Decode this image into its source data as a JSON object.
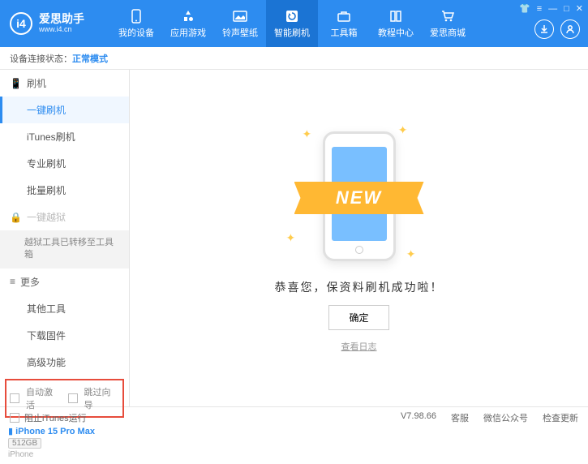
{
  "app": {
    "title": "爱思助手",
    "subtitle": "www.i4.cn"
  },
  "nav": {
    "items": [
      {
        "label": "我的设备"
      },
      {
        "label": "应用游戏"
      },
      {
        "label": "铃声壁纸"
      },
      {
        "label": "智能刷机"
      },
      {
        "label": "工具箱"
      },
      {
        "label": "教程中心"
      },
      {
        "label": "爱思商城"
      }
    ]
  },
  "status": {
    "label": "设备连接状态：",
    "mode": "正常模式"
  },
  "sidebar": {
    "group_flash": "刷机",
    "items": {
      "one_click": "一键刷机",
      "itunes": "iTunes刷机",
      "pro": "专业刷机",
      "batch": "批量刷机"
    },
    "group_jailbreak": "一键越狱",
    "jailbreak_note": "越狱工具已转移至工具箱",
    "group_more": "更多",
    "more": {
      "other_tools": "其他工具",
      "download_fw": "下载固件",
      "advanced": "高级功能"
    },
    "checks": {
      "auto_activate": "自动激活",
      "skip_setup": "跳过向导"
    }
  },
  "device": {
    "name": "iPhone 15 Pro Max",
    "storage": "512GB",
    "type": "iPhone"
  },
  "main": {
    "ribbon": "NEW",
    "success_msg": "恭喜您，保资料刷机成功啦！",
    "ok": "确定",
    "view_log": "查看日志"
  },
  "footer": {
    "block_itunes": "阻止iTunes运行",
    "version": "V7.98.66",
    "service": "客服",
    "wechat": "微信公众号",
    "update": "检查更新"
  }
}
